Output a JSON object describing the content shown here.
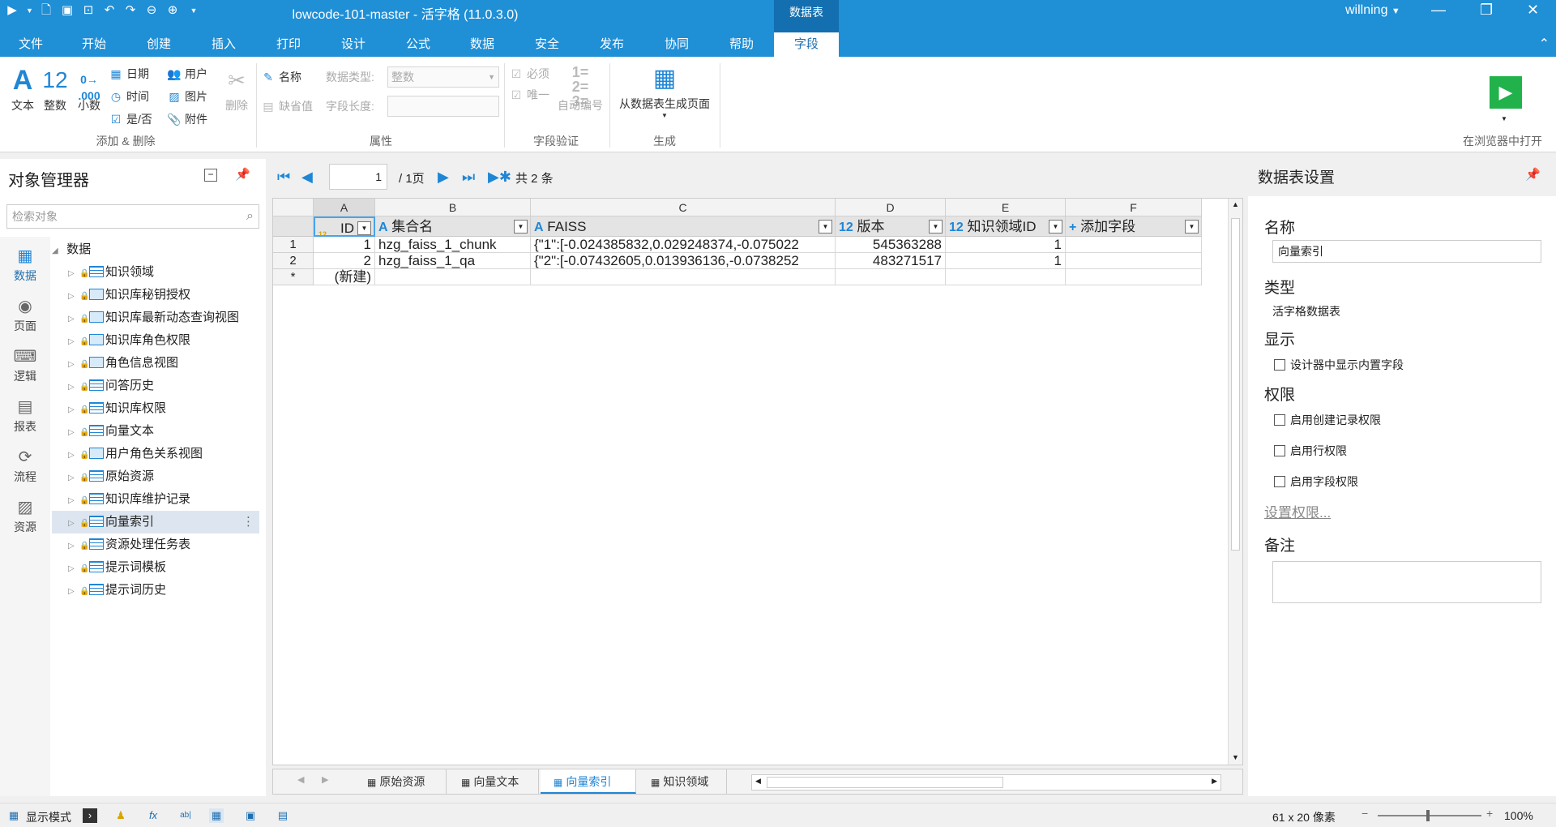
{
  "titlebar": {
    "title": "lowcode-101-master - 活字格 (11.0.3.0)",
    "context_tab": "数据表",
    "user": "willning",
    "quick_access": [
      "run-icon",
      "dropdown-icon",
      "new-icon",
      "save-icon",
      "open-icon",
      "undo-icon",
      "redo-icon",
      "back-icon",
      "forward-icon",
      "customize-icon"
    ]
  },
  "ribbon_tabs": [
    "文件",
    "开始",
    "创建",
    "插入",
    "打印",
    "设计",
    "公式",
    "数据",
    "安全",
    "发布",
    "协同",
    "帮助",
    "字段"
  ],
  "active_tab": "字段",
  "ribbon": {
    "add_delete": {
      "label": "添加 & 删除",
      "text": "文本",
      "integer": "整数",
      "decimal": "小数",
      "date": "日期",
      "time": "时间",
      "boolean": "是/否",
      "user": "用户",
      "image": "图片",
      "attachment": "附件",
      "delete": "删除"
    },
    "properties": {
      "label": "属性",
      "name": "名称",
      "default": "缺省值",
      "data_type_label": "数据类型:",
      "data_type_value": "整数",
      "field_length_label": "字段长度:"
    },
    "validation": {
      "label": "字段验证",
      "required": "必须",
      "unique": "唯一",
      "auto_number": "自动编号"
    },
    "generate": {
      "label": "生成",
      "from_table": "从数据表生成页面"
    },
    "open_browser": "在浏览器中打开"
  },
  "left_panel": {
    "title": "对象管理器",
    "search_placeholder": "检索对象",
    "side_tabs": [
      "数据",
      "页面",
      "逻辑",
      "报表",
      "流程",
      "资源"
    ],
    "active_side_tab": "数据",
    "root": "数据",
    "items": [
      {
        "label": "知识领域",
        "kind": "table"
      },
      {
        "label": "知识库秘钥授权",
        "kind": "view"
      },
      {
        "label": "知识库最新动态查询视图",
        "kind": "view"
      },
      {
        "label": "知识库角色权限",
        "kind": "view"
      },
      {
        "label": "角色信息视图",
        "kind": "view"
      },
      {
        "label": "问答历史",
        "kind": "table"
      },
      {
        "label": "知识库权限",
        "kind": "table"
      },
      {
        "label": "向量文本",
        "kind": "table"
      },
      {
        "label": "用户角色关系视图",
        "kind": "view"
      },
      {
        "label": "原始资源",
        "kind": "table"
      },
      {
        "label": "知识库维护记录",
        "kind": "table"
      },
      {
        "label": "向量索引",
        "kind": "table",
        "selected": true
      },
      {
        "label": "资源处理任务表",
        "kind": "table"
      },
      {
        "label": "提示词模板",
        "kind": "table"
      },
      {
        "label": "提示词历史",
        "kind": "table"
      }
    ]
  },
  "grid": {
    "page_value": "1",
    "page_total": "/ 1页",
    "record_count": "共 2 条",
    "columns": [
      "A",
      "B",
      "C",
      "D",
      "E",
      "F"
    ],
    "fields": [
      {
        "name": "ID",
        "type": "12"
      },
      {
        "name": "集合名",
        "type": "A"
      },
      {
        "name": "FAISS",
        "type": "A"
      },
      {
        "name": "版本",
        "type": "12"
      },
      {
        "name": "知识领域ID",
        "type": "12"
      },
      {
        "name": "添加字段",
        "type": "+"
      }
    ],
    "rows": [
      {
        "header": "1",
        "cells": [
          "1",
          "hzg_faiss_1_chunk",
          "{\"1\":[-0.024385832,0.029248374,-0.075022",
          "545363288",
          "1",
          ""
        ]
      },
      {
        "header": "2",
        "cells": [
          "2",
          "hzg_faiss_1_qa",
          "{\"2\":[-0.07432605,0.013936136,-0.0738252",
          "483271517",
          "1",
          ""
        ]
      }
    ],
    "new_row_header": "*",
    "new_row_label": "(新建)"
  },
  "sheet_tabs": [
    "原始资源",
    "向量文本",
    "向量索引",
    "知识领域"
  ],
  "active_sheet": "向量索引",
  "right_panel": {
    "title": "数据表设置",
    "name_label": "名称",
    "name_value": "向量索引",
    "type_label": "类型",
    "type_value": "活字格数据表",
    "display_label": "显示",
    "display_option": "设计器中显示内置字段",
    "permission_label": "权限",
    "permission_options": [
      "启用创建记录权限",
      "启用行权限",
      "启用字段权限"
    ],
    "set_permission_link": "设置权限...",
    "note_label": "备注"
  },
  "statusbar": {
    "display_mode": "显示模式",
    "size": "61 x 20 像素",
    "zoom": "100%"
  },
  "colors": {
    "accent": "#1f8fd6",
    "ribbon_bg": "#ffffff",
    "selection": "#dde6f0"
  }
}
